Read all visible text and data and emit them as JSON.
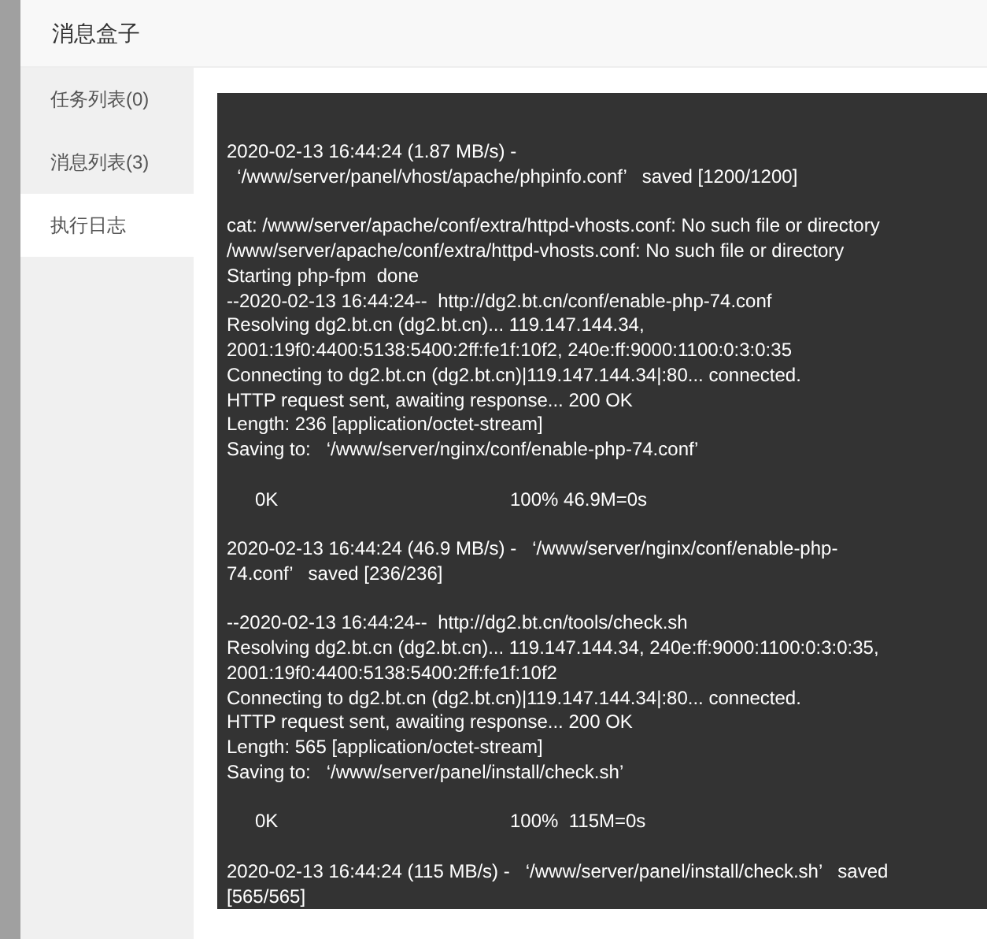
{
  "dialog": {
    "title": "消息盒子"
  },
  "sidebar": {
    "items": [
      {
        "label": "任务列表(0)",
        "selected": false
      },
      {
        "label": "消息列表(3)",
        "selected": false
      },
      {
        "label": "执行日志",
        "selected": true
      }
    ]
  },
  "log": {
    "blocks": [
      {
        "kind": "text",
        "lines": [
          "2020-02-13 16:44:24 (1.87 MB/s) -",
          "  ‘/www/server/panel/vhost/apache/phpinfo.conf’   saved [1200/1200]"
        ]
      },
      {
        "kind": "text",
        "lines": [
          "cat: /www/server/apache/conf/extra/httpd-vhosts.conf: No such file or directory",
          "/www/server/apache/conf/extra/httpd-vhosts.conf: No such file or directory",
          "Starting php-fpm  done",
          "--2020-02-13 16:44:24--  http://dg2.bt.cn/conf/enable-php-74.conf",
          "Resolving dg2.bt.cn (dg2.bt.cn)... 119.147.144.34,",
          "2001:19f0:4400:5138:5400:2ff:fe1f:10f2, 240e:ff:9000:1100:0:3:0:35",
          "Connecting to dg2.bt.cn (dg2.bt.cn)|119.147.144.34|:80... connected.",
          "HTTP request sent, awaiting response... 200 OK",
          "Length: 236 [application/octet-stream]",
          "Saving to:   ‘/www/server/nginx/conf/enable-php-74.conf’"
        ]
      },
      {
        "kind": "progress",
        "left": "0K",
        "right": "100% 46.9M=0s"
      },
      {
        "kind": "text",
        "lines": [
          "2020-02-13 16:44:24 (46.9 MB/s) -   ‘/www/server/nginx/conf/enable-php-",
          "74.conf’   saved [236/236]"
        ]
      },
      {
        "kind": "text",
        "lines": [
          "--2020-02-13 16:44:24--  http://dg2.bt.cn/tools/check.sh",
          "Resolving dg2.bt.cn (dg2.bt.cn)... 119.147.144.34, 240e:ff:9000:1100:0:3:0:35,",
          "2001:19f0:4400:5138:5400:2ff:fe1f:10f2",
          "Connecting to dg2.bt.cn (dg2.bt.cn)|119.147.144.34|:80... connected.",
          "HTTP request sent, awaiting response... 200 OK",
          "Length: 565 [application/octet-stream]",
          "Saving to:   ‘/www/server/panel/install/check.sh’"
        ]
      },
      {
        "kind": "progress",
        "left": "0K",
        "right": "100%  115M=0s"
      },
      {
        "kind": "text",
        "lines": [
          "2020-02-13 16:44:24 (115 MB/s) -   ‘/www/server/panel/install/check.sh’   saved",
          "[565/565]"
        ]
      }
    ]
  }
}
